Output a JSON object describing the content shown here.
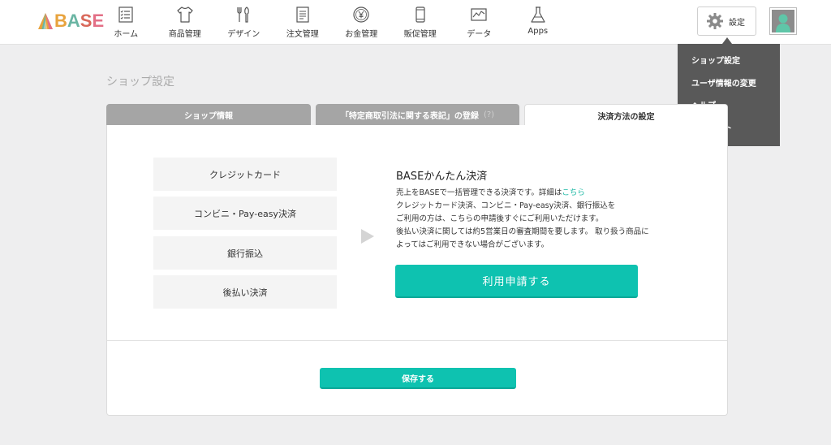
{
  "brand": {
    "logo_text": "BASE"
  },
  "nav": [
    {
      "label": "ホーム",
      "icon": "home-list-icon"
    },
    {
      "label": "商品管理",
      "icon": "shirt-icon"
    },
    {
      "label": "デザイン",
      "icon": "tools-icon"
    },
    {
      "label": "注文管理",
      "icon": "document-icon"
    },
    {
      "label": "お金管理",
      "icon": "yen-coin-icon"
    },
    {
      "label": "販促管理",
      "icon": "smartphone-icon"
    },
    {
      "label": "データ",
      "icon": "chart-icon"
    },
    {
      "label": "Apps",
      "icon": "flask-icon"
    }
  ],
  "header": {
    "settings_label": "設定"
  },
  "dropdown": {
    "items": [
      "ショップ設定",
      "ユーザ情報の変更",
      "ヘルプ",
      "ログアウト"
    ]
  },
  "page": {
    "title": "ショップ設定"
  },
  "tabs": [
    {
      "label": "ショップ情報",
      "active": false
    },
    {
      "label": "「特定商取引法に関する表記」の登録",
      "help": "(?)",
      "active": false
    },
    {
      "label": "決済方法の設定",
      "active": true
    }
  ],
  "methods": [
    "クレジットカード",
    "コンビニ・Pay-easy決済",
    "銀行振込",
    "後払い決済"
  ],
  "info": {
    "title": "BASEかんたん決済",
    "line1_prefix": "売上をBASEで一括管理できる決済です。詳細は",
    "line1_link": "こちら",
    "line2": "クレジットカード決済、コンビニ・Pay-easy決済、銀行振込を",
    "line3": "ご利用の方は、こちらの申請後すぐにご利用いただけます。",
    "line4": "後払い決済に関しては約5営業日の審査期間を要します。 取り扱う商品に",
    "line5": "よってはご利用できない場合がございます。",
    "apply_label": "利用申請する"
  },
  "footer": {
    "save_label": "保存する"
  },
  "colors": {
    "accent": "#0ec2b0",
    "link": "#1fb9a5",
    "dropdown_bg": "#595959",
    "tab_inactive": "#a5a5a5"
  }
}
